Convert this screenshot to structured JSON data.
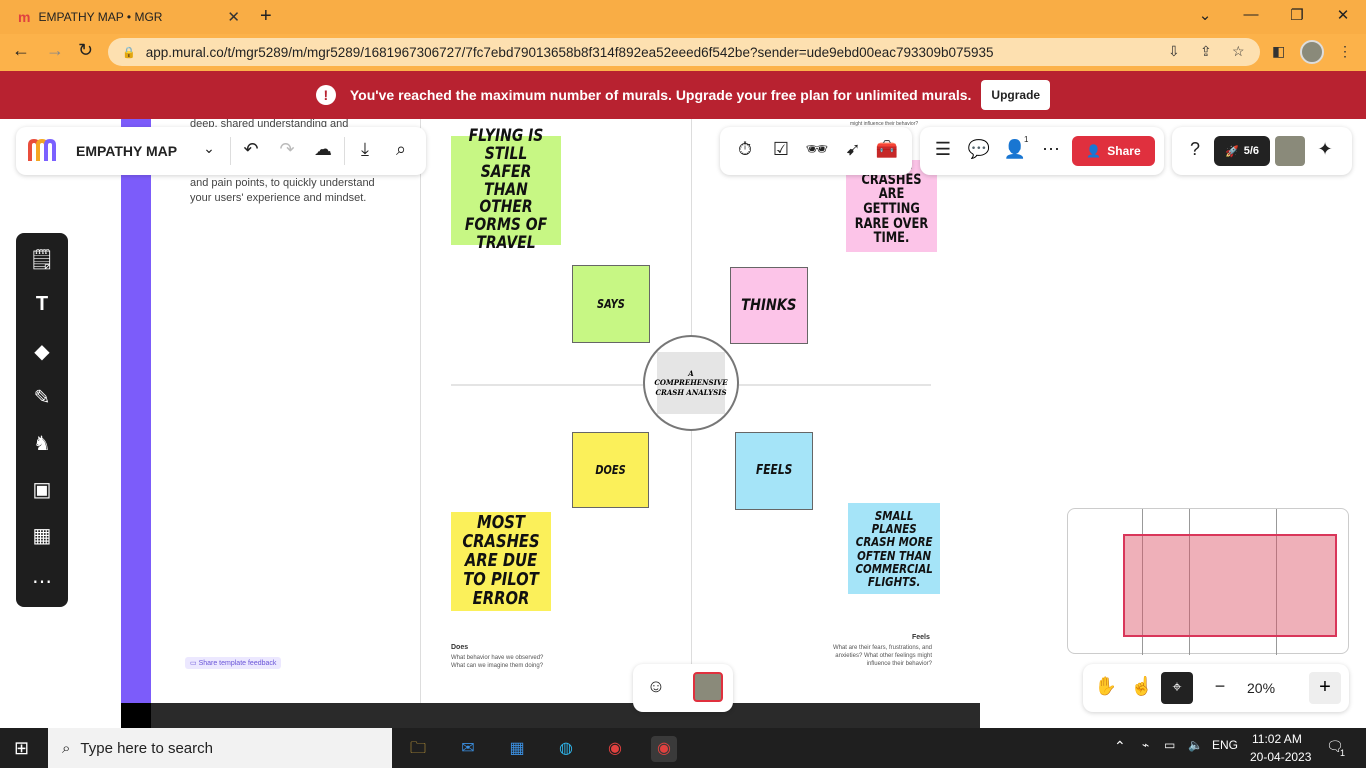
{
  "browser": {
    "tab_title": "EMPATHY MAP • MGR",
    "tab_favicon": "m",
    "url": "app.mural.co/t/mgr5289/m/mgr5289/1681967306727/7fc7ebd79013658b8f314f892ea52eeed6f542be?sender=ude9ebd00eac793309b075935"
  },
  "banner": {
    "message": "You've reached the maximum number of murals. Upgrade your free plan for unlimited murals.",
    "upgrade_label": "Upgrade"
  },
  "toolbar": {
    "mural_title": "EMPATHY MAP",
    "share_label": "Share",
    "members_badge": "1",
    "count_label": "5/6"
  },
  "left_panel": {
    "text_top": "deep, shared understanding and",
    "text_body": "and pain points, to quickly understand your users' experience and mindset.",
    "feedback_label": "Share template feedback"
  },
  "board": {
    "center_title": "A COMPREHENSIVE CRASH ANALYSIS",
    "top_right_tiny": "might influence their behavior?",
    "stickies": {
      "flying_safer": "FLYING IS STILL SAFER THAN OTHER FORMS OF TRAVEL",
      "plane_crashes": "PLANE CRASHES ARE GETTING RARE OVER TIME.",
      "says": "SAYS",
      "thinks": "THINKS",
      "does": "DOES",
      "feels": "FEELS",
      "pilot_error": "MOST CRASHES ARE DUE TO PILOT ERROR",
      "small_planes": "SMALL PLANES CRASH MORE OFTEN THAN COMMERCIAL FLIGHTS."
    },
    "does_label": "Does",
    "does_desc": "What behavior have we observed? What can we imagine them doing?",
    "feels_label": "Feels",
    "feels_desc": "What are their fears, frustrations, and anxieties? What other feelings might influence their behavior?"
  },
  "zoom": {
    "level": "20%"
  },
  "taskbar": {
    "search_placeholder": "Type here to search",
    "language": "ENG",
    "time": "11:02 AM",
    "date": "20-04-2023",
    "notifications": "1"
  }
}
